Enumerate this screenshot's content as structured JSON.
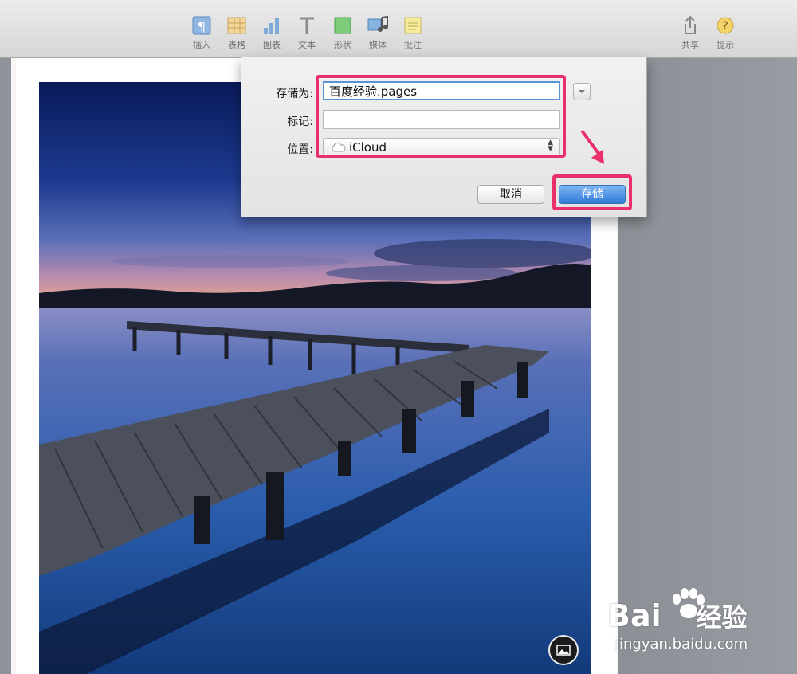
{
  "toolbar": {
    "items": [
      {
        "label": "插入",
        "icon": "insert-icon"
      },
      {
        "label": "表格",
        "icon": "table-icon"
      },
      {
        "label": "图表",
        "icon": "chart-icon"
      },
      {
        "label": "文本",
        "icon": "text-icon"
      },
      {
        "label": "形状",
        "icon": "shape-icon"
      },
      {
        "label": "媒体",
        "icon": "media-icon"
      },
      {
        "label": "批注",
        "icon": "comment-icon"
      }
    ],
    "share_label": "共享",
    "tips_label": "提示"
  },
  "save_dialog": {
    "save_as_label": "存储为:",
    "save_as_value": "百度经验.pages",
    "tags_label": "标记:",
    "tags_value": "",
    "location_label": "位置:",
    "location_value": "iCloud",
    "cancel_label": "取消",
    "save_label": "存储"
  },
  "watermark": {
    "logo_latin": "Bai",
    "logo_cn": "经验",
    "url": "jingyan.baidu.com"
  },
  "colors": {
    "highlight": "#ea2f6a",
    "accent_button": "#2f7ad8",
    "toolbar_bg": "#dcdcdc"
  }
}
